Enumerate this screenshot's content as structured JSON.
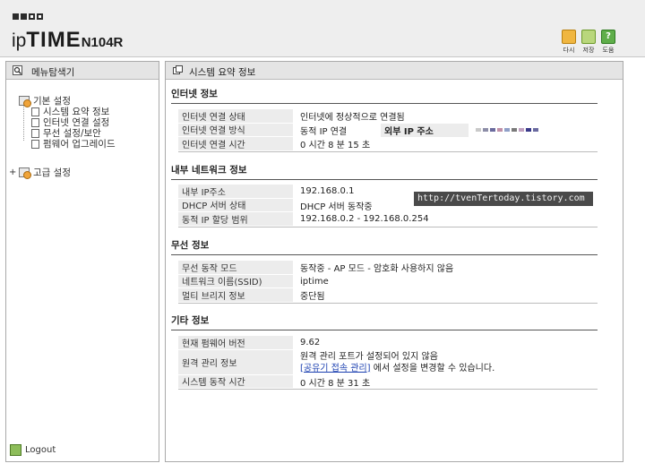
{
  "header": {
    "logo_ip": "ip",
    "logo_time": "TIME",
    "logo_model": "N104R",
    "tools": [
      {
        "label": "다시",
        "icon": "refresh-icon"
      },
      {
        "label": "저장",
        "icon": "save-icon"
      },
      {
        "label": "도움",
        "icon": "help-icon"
      }
    ]
  },
  "left_panel": {
    "title": "메뉴탐색기",
    "tree": {
      "basic": "기본 설정",
      "basic_items": [
        "시스템 요약 정보",
        "인터넷 연결 설정",
        "무선 설정/보안",
        "펌웨어 업그레이드"
      ],
      "advanced_toggle": "+",
      "advanced": "고급 설정"
    },
    "logout": "Logout"
  },
  "right_panel": {
    "title": "시스템 요약 정보",
    "internet": {
      "title": "인터넷 정보",
      "rows": [
        {
          "k": "인터넷 연결 상태",
          "v": "인터넷에 정상적으로 연결됨"
        },
        {
          "k": "인터넷 연결 방식",
          "v": "동적 IP 연결"
        },
        {
          "k": "인터넷 연결 시간",
          "v": "0 시간 8 분 15 초"
        }
      ],
      "external_ip_label": "외부 IP 주소"
    },
    "internal": {
      "title": "내부 네트워크 정보",
      "rows": [
        {
          "k": "내부 IP주소",
          "v": "192.168.0.1"
        },
        {
          "k": "DHCP 서버 상태",
          "v": "DHCP 서버 동작중"
        },
        {
          "k": "동적 IP 할당 범위",
          "v": "192.168.0.2 - 192.168.0.254"
        }
      ]
    },
    "wireless": {
      "title": "무선 정보",
      "rows": [
        {
          "k": "무선 동작 모드",
          "v": "동작중 - AP 모드 - 암호화 사용하지 않음"
        },
        {
          "k": "네트워크 이름(SSID)",
          "v": "iptime"
        },
        {
          "k": "멀티 브리지 정보",
          "v": "중단됨"
        }
      ]
    },
    "other": {
      "title": "기타 정보",
      "fw_k": "현재 펌웨어 버전",
      "fw_v": "9.62",
      "remote_k": "원격 관리 정보",
      "remote_line1": "원격 관리 포트가 설정되어 있지 않음",
      "remote_link": "[공유기 접속 관리]",
      "remote_line2_rest": "에서 설정을 변경할 수 있습니다.",
      "uptime_k": "시스템 동작 시간",
      "uptime_v": "0 시간 8 분 31 초"
    }
  },
  "watermark": "http://tvenTertoday.tistory.com",
  "colors": {
    "header_bg": "#eeeeee",
    "panel_head_bg": "#e4e4e4",
    "key_cell_bg": "#ececec",
    "link": "#1a3fb0"
  }
}
